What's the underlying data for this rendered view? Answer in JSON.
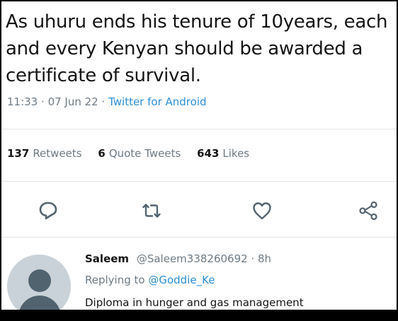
{
  "tweet": {
    "text": "As uhuru ends his tenure of 10years, each and every Kenyan should be awarded a certificate of survival.",
    "time": "11:33",
    "date": "07 Jun 22",
    "separator": "·",
    "source": "Twitter for Android"
  },
  "stats": {
    "retweets_count": "137",
    "retweets_label": "Retweets",
    "quote_tweets_count": "6",
    "quote_tweets_label": "Quote Tweets",
    "likes_count": "643",
    "likes_label": "Likes"
  },
  "actions": {
    "icons": [
      "reply-icon",
      "retweet-icon",
      "like-icon",
      "share-icon"
    ]
  },
  "reply": {
    "name": "Saleem",
    "handle": "@Saleem338260692",
    "time": "8h",
    "separator": "·",
    "replying_to_label": "Replying to",
    "replying_to_handle": "@Goddie_Ke",
    "text": "Diploma in hunger and gas management"
  },
  "colors": {
    "text": "#141414",
    "secondary": "#6e7b85",
    "accent": "#2a8fd6",
    "divider": "#dfe3e6",
    "avatar_bg": "#c9d2d8",
    "avatar_fg": "#526370",
    "background": "#ffffff",
    "frame": "#000000"
  }
}
